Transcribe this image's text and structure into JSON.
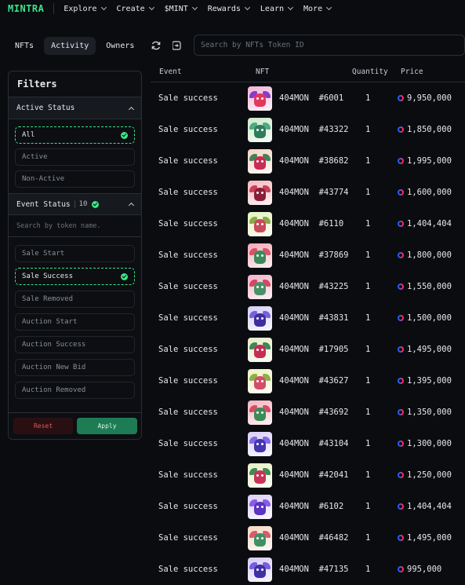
{
  "brand": {
    "logo": "MINTRA"
  },
  "nav": [
    {
      "label": "Explore",
      "dropdown": true
    },
    {
      "label": "Create",
      "dropdown": true
    },
    {
      "label": "$MINT",
      "dropdown": true
    },
    {
      "label": "Rewards",
      "dropdown": true
    },
    {
      "label": "Learn",
      "dropdown": true
    },
    {
      "label": "More",
      "dropdown": true
    }
  ],
  "tabs": [
    {
      "label": "NFTs",
      "active": false
    },
    {
      "label": "Activity",
      "active": true
    },
    {
      "label": "Owners",
      "active": false
    }
  ],
  "toolbar": {
    "refresh_icon": "refresh-icon",
    "collapse_icon": "panel-toggle-icon"
  },
  "search": {
    "placeholder": "Search by NFTs Token ID"
  },
  "filters": {
    "title": "Filters",
    "active_status": {
      "label": "Active Status",
      "options": [
        {
          "label": "All",
          "selected": true
        },
        {
          "label": "Active",
          "selected": false
        },
        {
          "label": "Non-Active",
          "selected": false
        }
      ]
    },
    "event_status": {
      "label": "Event Status",
      "count": "10",
      "search_placeholder": "Search by token name.",
      "options": [
        {
          "label": "Sale Start",
          "selected": false
        },
        {
          "label": "Sale Success",
          "selected": true
        },
        {
          "label": "Sale Removed",
          "selected": false
        },
        {
          "label": "Auction Start",
          "selected": false
        },
        {
          "label": "Auction Success",
          "selected": false
        },
        {
          "label": "Auction New Bid",
          "selected": false
        },
        {
          "label": "Auction Removed",
          "selected": false
        }
      ]
    },
    "reset_label": "Reset",
    "apply_label": "Apply"
  },
  "table": {
    "headers": {
      "event": "Event",
      "nft": "NFT",
      "quantity": "Quantity",
      "price": "Price"
    },
    "rows": [
      {
        "event": "Sale success",
        "nft": "404MON  #6001",
        "quantity": "1",
        "price": "9,950,000",
        "palette": [
          "#f0b4d8",
          "#7a2cc7",
          "#e2385c"
        ]
      },
      {
        "event": "Sale success",
        "nft": "404MON  #43322",
        "quantity": "1",
        "price": "1,850,000",
        "palette": [
          "#cfe9c9",
          "#3ea37a",
          "#2f7c5d"
        ]
      },
      {
        "event": "Sale success",
        "nft": "404MON  #38682",
        "quantity": "1",
        "price": "1,995,000",
        "palette": [
          "#f6d2c4",
          "#2c7a47",
          "#c92c55"
        ]
      },
      {
        "event": "Sale success",
        "nft": "404MON  #43774",
        "quantity": "1",
        "price": "1,600,000",
        "palette": [
          "#f7b7bd",
          "#c2334a",
          "#8b1f3a"
        ]
      },
      {
        "event": "Sale success",
        "nft": "404MON  #6110",
        "quantity": "1",
        "price": "1,404,404",
        "palette": [
          "#e7f0c0",
          "#7aa33a",
          "#c94b5a"
        ]
      },
      {
        "event": "Sale success",
        "nft": "404MON  #37869",
        "quantity": "1",
        "price": "1,800,000",
        "palette": [
          "#f3a9b6",
          "#d8455c",
          "#3a8a5a"
        ]
      },
      {
        "event": "Sale success",
        "nft": "404MON  #43225",
        "quantity": "1",
        "price": "1,550,000",
        "palette": [
          "#f4b1c6",
          "#cf3a58",
          "#4a9066"
        ]
      },
      {
        "event": "Sale success",
        "nft": "404MON  #43831",
        "quantity": "1",
        "price": "1,500,000",
        "palette": [
          "#d6cdf6",
          "#6a55d8",
          "#3e2f9f"
        ]
      },
      {
        "event": "Sale success",
        "nft": "404MON  #17905",
        "quantity": "1",
        "price": "1,495,000",
        "palette": [
          "#e4ecc6",
          "#2d7a4a",
          "#c52d55"
        ]
      },
      {
        "event": "Sale success",
        "nft": "404MON  #43627",
        "quantity": "1",
        "price": "1,395,000",
        "palette": [
          "#eef2c0",
          "#7fa83a",
          "#d0506b"
        ]
      },
      {
        "event": "Sale success",
        "nft": "404MON  #43692",
        "quantity": "1",
        "price": "1,350,000",
        "palette": [
          "#f5b3bf",
          "#d03e5a",
          "#3c8a58"
        ]
      },
      {
        "event": "Sale success",
        "nft": "404MON  #43104",
        "quantity": "1",
        "price": "1,300,000",
        "palette": [
          "#d9cff7",
          "#7a5ae0",
          "#4634b0"
        ]
      },
      {
        "event": "Sale success",
        "nft": "404MON  #42041",
        "quantity": "1",
        "price": "1,250,000",
        "palette": [
          "#e6efc4",
          "#2f7d49",
          "#c83358"
        ]
      },
      {
        "event": "Sale success",
        "nft": "404MON  #6102",
        "quantity": "1",
        "price": "1,404,404",
        "palette": [
          "#dccff8",
          "#7d4fe3",
          "#5a35c0"
        ]
      },
      {
        "event": "Sale success",
        "nft": "404MON  #46482",
        "quantity": "1",
        "price": "1,495,000",
        "palette": [
          "#f6d6c4",
          "#d84a5f",
          "#3e9063"
        ]
      },
      {
        "event": "Sale success",
        "nft": "404MON  #47135",
        "quantity": "1",
        "price": "995,000",
        "palette": [
          "#d6ccf6",
          "#6c52dd",
          "#3f2fa5"
        ]
      }
    ]
  },
  "colors": {
    "accent": "#3de48a",
    "background": "#0a0c10",
    "border": "#2a2e35",
    "reset": "#e05a5a",
    "apply": "#1e7c55"
  }
}
